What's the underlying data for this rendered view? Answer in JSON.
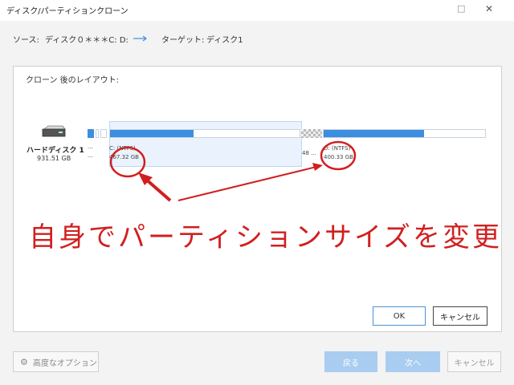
{
  "window": {
    "title": "ディスク/パーティションクローン",
    "minimize_glyph": "□",
    "close_glyph": "✕"
  },
  "path": {
    "source_label": "ソース:",
    "source_value": "ディスク０＊＊＊C: D:",
    "target_label": "ターゲット:",
    "target_value": "ディスク1"
  },
  "panel": {
    "title": "クローン 後のレイアウト:"
  },
  "disk": {
    "name": "ハードディスク 1",
    "size": "931.51 GB",
    "icon": "hard-drive-icon"
  },
  "partitions": {
    "small_dots_1": "...",
    "small_dots_2": "...",
    "c": {
      "label": "C: (NTFS)",
      "size": "467.32 GB",
      "fill_fraction": 0.44
    },
    "unalloc_label": "48 ...",
    "d": {
      "label": "D: (NTFS)",
      "size": "400.33 GB",
      "fill_fraction": 0.62
    }
  },
  "annotation": {
    "text": "自身でパーティションサイズを変更",
    "color": "#d11f1f"
  },
  "buttons": {
    "ok": "OK",
    "inner_cancel": "キャンセル",
    "advanced": "高度なオプション",
    "back": "戻る",
    "next": "次へ",
    "cancel": "キャンセル"
  },
  "colors": {
    "accent": "#3c8ee0",
    "disabled_primary": "#a9cdf0",
    "annotation": "#d11f1f"
  }
}
